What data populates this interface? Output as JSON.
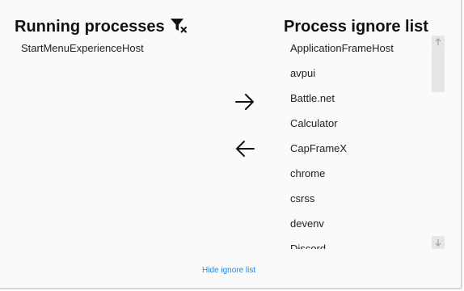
{
  "running": {
    "title": "Running processes",
    "filter_icon": "filter-clear-icon",
    "items": [
      {
        "label": "StartMenuExperienceHost"
      }
    ]
  },
  "transfer": {
    "move_right_icon": "arrow-right-icon",
    "move_left_icon": "arrow-left-icon"
  },
  "ignore": {
    "title": "Process ignore list",
    "items": [
      {
        "label": "ApplicationFrameHost"
      },
      {
        "label": "avpui"
      },
      {
        "label": "Battle.net"
      },
      {
        "label": "Calculator"
      },
      {
        "label": "CapFrameX"
      },
      {
        "label": "chrome"
      },
      {
        "label": "csrss"
      },
      {
        "label": "devenv"
      },
      {
        "label": "Discord"
      }
    ]
  },
  "footer": {
    "hide_link": "Hide ignore list"
  },
  "colors": {
    "link": "#1e88e5",
    "background": "#fafafa",
    "scrollbar": "#e6e6e6"
  }
}
